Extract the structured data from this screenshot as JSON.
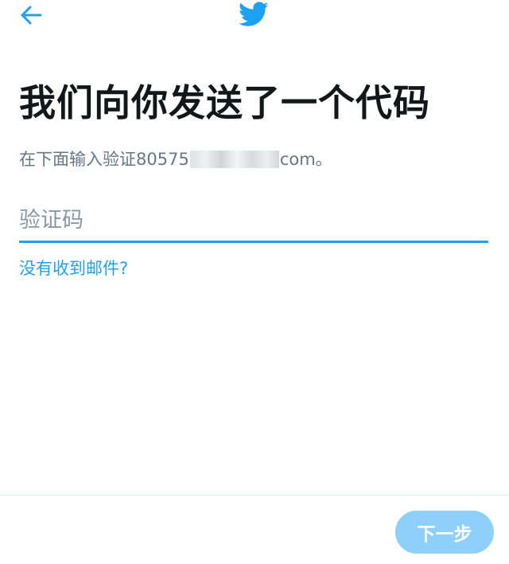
{
  "header": {
    "back_icon": "arrow-left-icon",
    "logo_icon": "twitter-bird-icon",
    "accent_color": "#1da1f2"
  },
  "main": {
    "title": "我们向你发送了一个代码",
    "subtitle_prefix": "在下面输入验证80575",
    "subtitle_suffix": "com。",
    "code_input": {
      "placeholder": "验证码",
      "value": ""
    },
    "resend_link": "没有收到邮件?"
  },
  "footer": {
    "next_button": "下一步",
    "next_button_color": "#8ed0f9"
  }
}
